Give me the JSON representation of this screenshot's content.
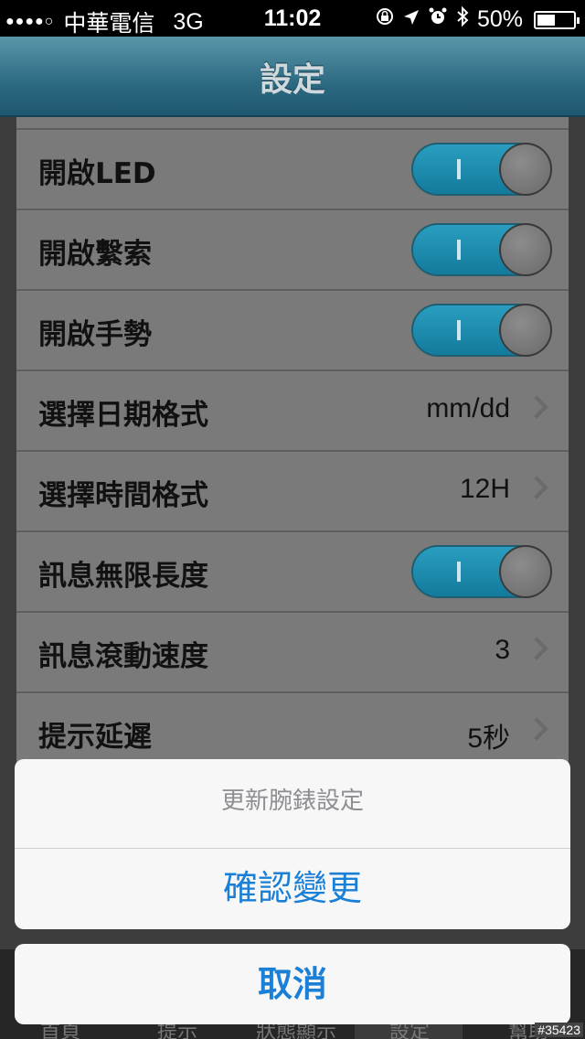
{
  "status_bar": {
    "signal": "●●●●○",
    "carrier": "中華電信",
    "network": "3G",
    "time": "11:02",
    "icons": [
      "rotation-lock-icon",
      "location-icon",
      "alarm-icon",
      "bluetooth-icon"
    ],
    "battery_percent": "50%",
    "battery_level": 0.5
  },
  "navbar": {
    "title": "設定"
  },
  "settings": {
    "items": [
      {
        "label": "開啟LED",
        "type": "toggle",
        "on": true
      },
      {
        "label": "開啟繫索",
        "type": "toggle",
        "on": true
      },
      {
        "label": "開啟手勢",
        "type": "toggle",
        "on": true
      },
      {
        "label": "選擇日期格式",
        "type": "value",
        "value": "mm/dd"
      },
      {
        "label": "選擇時間格式",
        "type": "value",
        "value": "12H"
      },
      {
        "label": "訊息無限長度",
        "type": "toggle",
        "on": true
      },
      {
        "label": "訊息滾動速度",
        "type": "value",
        "value": "3"
      },
      {
        "label": "提示延遲",
        "type": "value",
        "value": "5秒"
      }
    ]
  },
  "tab_bar": {
    "tabs": [
      "首頁",
      "提示",
      "狀態顯示",
      "設定",
      "幫助"
    ],
    "active": "設定"
  },
  "action_sheet": {
    "title": "更新腕錶設定",
    "confirm_label": "確認變更",
    "cancel_label": "取消"
  },
  "watermark": "#35423",
  "colors": {
    "nav_bar": "#2c6a82",
    "toggle_on": "#1a8db0",
    "action_text": "#1a7fd6"
  }
}
